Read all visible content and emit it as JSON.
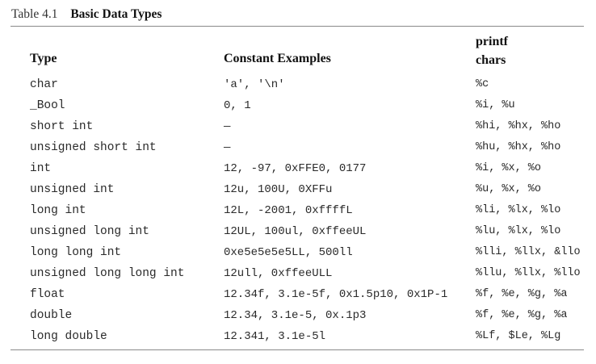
{
  "caption": {
    "number": "Table 4.1",
    "title": "Basic Data Types"
  },
  "headers": {
    "type": "Type",
    "constants": "Constant Examples",
    "printf": "printf chars"
  },
  "rows": [
    {
      "type": "char",
      "constants": "'a', '\\n'",
      "printf": "%c"
    },
    {
      "type": "_Bool",
      "constants": "0, 1",
      "printf": "%i, %u"
    },
    {
      "type": "short int",
      "constants": "—",
      "printf": "%hi, %hx, %ho"
    },
    {
      "type": "unsigned short int",
      "constants": "—",
      "printf": "%hu, %hx, %ho"
    },
    {
      "type": "int",
      "constants": "12, -97, 0xFFE0, 0177",
      "printf": "%i, %x, %o"
    },
    {
      "type": "unsigned int",
      "constants": "12u, 100U, 0XFFu",
      "printf": "%u, %x, %o"
    },
    {
      "type": "long int",
      "constants": "12L, -2001, 0xffffL",
      "printf": "%li, %lx, %lo"
    },
    {
      "type": "unsigned long int",
      "constants": "12UL, 100ul, 0xffeeUL",
      "printf": "%lu, %lx, %lo"
    },
    {
      "type": "long long int",
      "constants": "0xe5e5e5e5LL, 500ll",
      "printf": "%lli, %llx, &llo"
    },
    {
      "type": "unsigned long long int",
      "constants": "12ull, 0xffeeULL",
      "printf": "%llu, %llx, %llo"
    },
    {
      "type": "float",
      "constants": "12.34f, 3.1e-5f, 0x1.5p10, 0x1P-1",
      "printf": "%f, %e, %g, %a"
    },
    {
      "type": "double",
      "constants": "12.34, 3.1e-5, 0x.1p3",
      "printf": "%f, %e, %g, %a"
    },
    {
      "type": "long double",
      "constants": "12.341, 3.1e-5l",
      "printf": "%Lf, $Le, %Lg"
    }
  ]
}
